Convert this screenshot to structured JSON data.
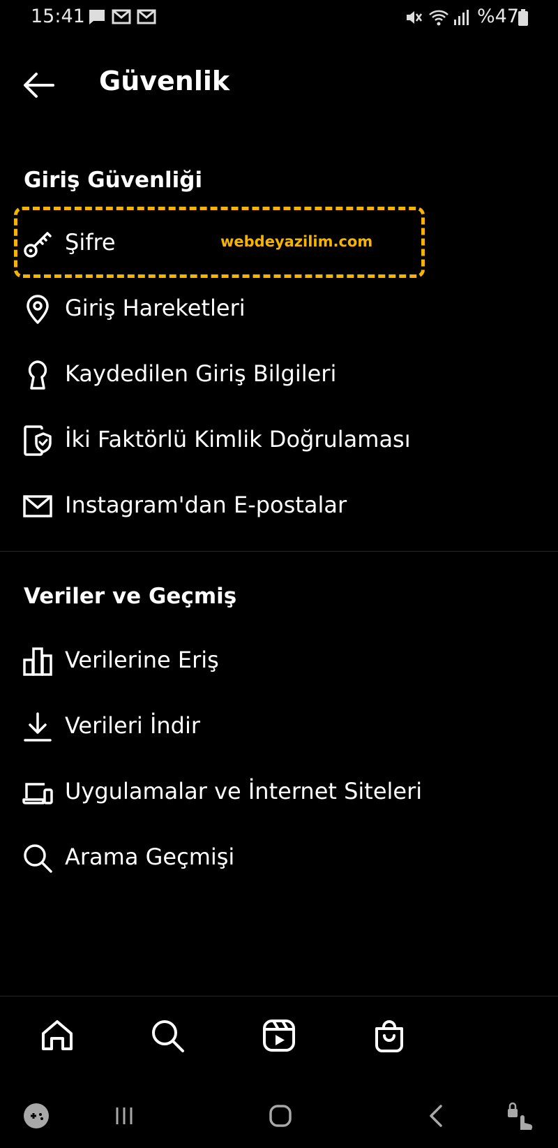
{
  "status_bar": {
    "time": "15:41",
    "battery": "%47",
    "icons": [
      "chat-icon",
      "mail-icon",
      "mail-icon",
      "mute-icon",
      "wifi-icon",
      "signal-icon",
      "battery-icon"
    ]
  },
  "header": {
    "title": "Güvenlik",
    "back_icon": "arrow-left-icon"
  },
  "sections": [
    {
      "title": "Giriş Güvenliği",
      "items": [
        {
          "label": "Şifre",
          "icon": "key-icon"
        },
        {
          "label": "Giriş Hareketleri",
          "icon": "location-pin-icon"
        },
        {
          "label": "Kaydedilen Giriş Bilgileri",
          "icon": "keyhole-icon"
        },
        {
          "label": "İki Faktörlü Kimlik Doğrulaması",
          "icon": "shield-phone-icon"
        },
        {
          "label": "Instagram'dan E-postalar",
          "icon": "envelope-icon"
        }
      ]
    },
    {
      "title": "Veriler ve Geçmiş",
      "items": [
        {
          "label": "Verilerine Eriş",
          "icon": "bar-chart-icon"
        },
        {
          "label": "Verileri İndir",
          "icon": "download-icon"
        },
        {
          "label": "Uygulamalar ve İnternet Siteleri",
          "icon": "devices-icon"
        },
        {
          "label": "Arama Geçmişi",
          "icon": "search-icon"
        }
      ]
    }
  ],
  "watermark": "webdeyazilim.com",
  "colors": {
    "background": "#000000",
    "text": "#ffffff",
    "highlight": "#f5b400",
    "divider": "#262626"
  },
  "bottom_nav": [
    "home-icon",
    "search-icon",
    "reels-icon",
    "shop-icon"
  ],
  "system_nav": [
    "game-launcher-icon",
    "recents-icon",
    "home-button-icon",
    "back-icon",
    "lock-gesture-icon"
  ]
}
